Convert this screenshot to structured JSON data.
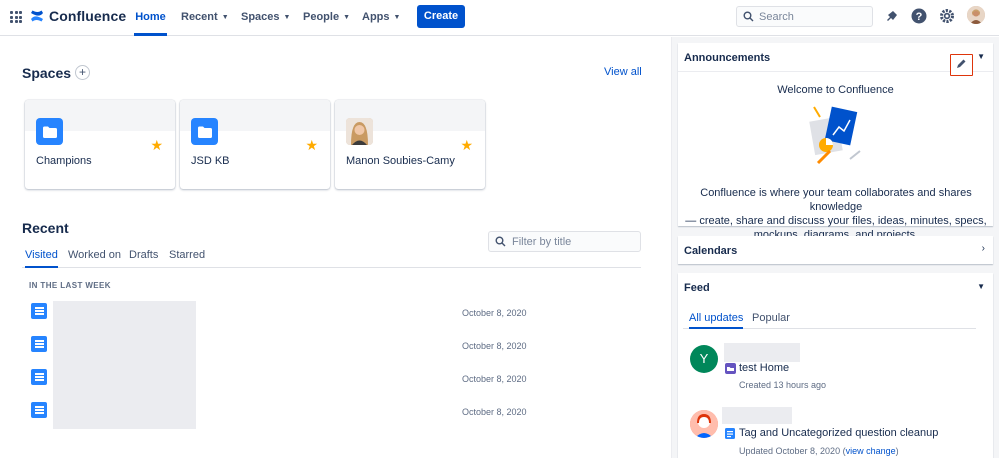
{
  "nav": {
    "brand": "Confluence",
    "items": [
      {
        "label": "Home",
        "chevron": false
      },
      {
        "label": "Recent",
        "chevron": true
      },
      {
        "label": "Spaces",
        "chevron": true
      },
      {
        "label": "People",
        "chevron": true
      },
      {
        "label": "Apps",
        "chevron": true
      }
    ],
    "create_label": "Create",
    "search_placeholder": "Search"
  },
  "spaces": {
    "heading": "Spaces",
    "add_label": "+",
    "view_all": "View all",
    "cards": [
      {
        "name": "Champions",
        "icon": "folder-icon",
        "starred": true
      },
      {
        "name": "JSD KB",
        "icon": "folder-icon",
        "starred": true
      },
      {
        "name": "Manon Soubies-Camy",
        "icon": "avatar-photo",
        "starred": true
      }
    ]
  },
  "recent": {
    "heading": "Recent",
    "filter_placeholder": "Filter by title",
    "tabs": [
      "Visited",
      "Worked on",
      "Drafts",
      "Starred"
    ],
    "section_label": "IN THE LAST WEEK",
    "rows": [
      {
        "date": "October 8, 2020"
      },
      {
        "date": "October 8, 2020"
      },
      {
        "date": "October 8, 2020"
      },
      {
        "date": "October 8, 2020"
      }
    ]
  },
  "announcements": {
    "title": "Announcements",
    "welcome": "Welcome to Confluence",
    "body_line1": "Confluence is where your team collaborates and shares knowledge",
    "body_line2": "— create, share and discuss your files, ideas, minutes, specs,",
    "body_line3": "mockups, diagrams, and projects."
  },
  "calendars": {
    "title": "Calendars"
  },
  "feed": {
    "title": "Feed",
    "tabs": [
      "All updates",
      "Popular"
    ],
    "items": [
      {
        "avatar_letter": "Y",
        "title": "test Home",
        "meta": "Created 13 hours ago",
        "link": ""
      },
      {
        "avatar_letter": "",
        "title": "Tag and Uncategorized question cleanup",
        "meta": "Updated October 8, 2020 (",
        "link": "view change",
        "meta_end": ")"
      }
    ]
  },
  "colors": {
    "primary": "#0052cc",
    "space_icon": "#2684ff",
    "star": "#ffab00",
    "highlight": "#de350b",
    "feed_avatar_y": "#00875a"
  }
}
